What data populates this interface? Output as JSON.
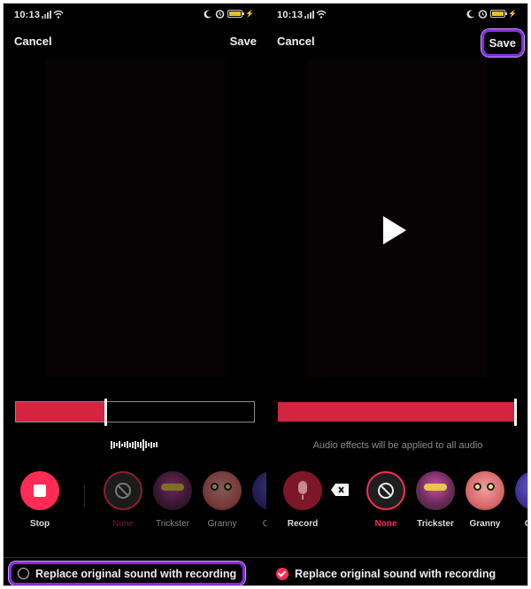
{
  "status_bar": {
    "time": "10:13",
    "icons": [
      "signal-icon",
      "wifi-icon",
      "moon-icon",
      "alarm-icon",
      "battery-icon",
      "charging-icon"
    ]
  },
  "left_panel": {
    "cancel_label": "Cancel",
    "save_label": "Save",
    "timeline_progress_percent": 38,
    "record_button_label": "Stop",
    "effects": [
      {
        "label": "None",
        "icon": "no-effect-icon",
        "selected": false
      },
      {
        "label": "Trickster",
        "icon": "trickster-avatar"
      },
      {
        "label": "Granny",
        "icon": "granny-avatar"
      },
      {
        "label": "Chip",
        "icon": "chipmunk-avatar"
      }
    ],
    "replace_option": {
      "label": "Replace original sound with recording",
      "checked": false
    }
  },
  "right_panel": {
    "cancel_label": "Cancel",
    "save_label": "Save",
    "timeline_progress_percent": 100,
    "info_text": "Audio effects will be applied to all audio",
    "record_button_label": "Record",
    "effects": [
      {
        "label": "None",
        "icon": "no-effect-icon",
        "selected": true
      },
      {
        "label": "Trickster",
        "icon": "trickster-avatar"
      },
      {
        "label": "Granny",
        "icon": "granny-avatar"
      },
      {
        "label": "Chip",
        "icon": "chipmunk-avatar"
      }
    ],
    "replace_option": {
      "label": "Replace original sound with recording",
      "checked": true
    }
  },
  "colors": {
    "accent": "#fe2c55",
    "timeline_fill": "#d4243f",
    "highlight": "#8a2be2"
  }
}
